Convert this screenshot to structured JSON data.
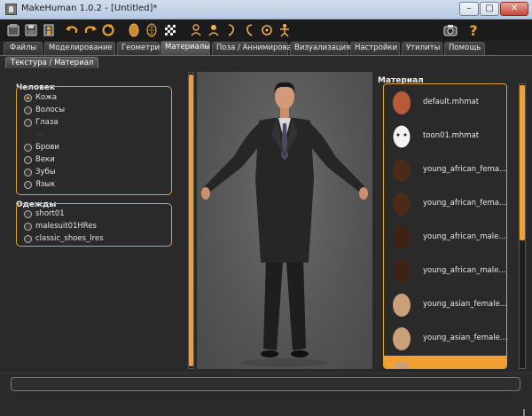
{
  "window": {
    "title": "MakeHuman 1.0.2 - [Untitled]*",
    "minimize": "–",
    "maximize": "□",
    "close": "✕"
  },
  "toolbar": {
    "icons": [
      "new-file-icon",
      "save-icon",
      "export-icon",
      "undo-icon",
      "redo-icon",
      "reset-icon",
      "smooth-icon",
      "wireframe-icon",
      "checkerboard-icon",
      "front-view-icon",
      "back-view-icon",
      "side-view-icon",
      "side-view-right-icon",
      "top-view-icon",
      "skeleton-icon",
      "screenshot-icon",
      "help-icon"
    ],
    "help_label": "?"
  },
  "tabs": [
    {
      "label": "Файлы"
    },
    {
      "label": "Моделирование"
    },
    {
      "label": "Геометрии"
    },
    {
      "label": "Материалы",
      "active": true
    },
    {
      "label": "Поза / Аннимировать"
    },
    {
      "label": "Визуализация"
    },
    {
      "label": "Настройки"
    },
    {
      "label": "Утилиты"
    },
    {
      "label": "Помощь"
    }
  ],
  "subtab": {
    "label": "Текстура / Материал"
  },
  "human_group": {
    "title": "Человек",
    "items": [
      {
        "label": "Кожа",
        "checked": true
      },
      {
        "label": "Волосы"
      },
      {
        "label": "Глаза"
      },
      {
        "label": "—",
        "dim": true
      },
      {
        "label": "Брови"
      },
      {
        "label": "Веки"
      },
      {
        "label": "Зубы"
      },
      {
        "label": "Язык"
      }
    ]
  },
  "clothes_group": {
    "title": "Одежды",
    "items": [
      {
        "label": "short01"
      },
      {
        "label": "malesuit01HRes"
      },
      {
        "label": "classic_shoes_lres"
      }
    ]
  },
  "material": {
    "title": "Материал",
    "items": [
      {
        "label": "default.mhmat",
        "skin": "#b85a3a"
      },
      {
        "label": "toon01.mhmat",
        "skin": "#f2f2f2"
      },
      {
        "label": "young_african_fema...",
        "skin": "#4a2a18"
      },
      {
        "label": "young_african_fema...",
        "skin": "#4a2a18"
      },
      {
        "label": "young_african_male...",
        "skin": "#3e2214"
      },
      {
        "label": "young_african_male...",
        "skin": "#3e2214"
      },
      {
        "label": "young_asian_female...",
        "skin": "#c9a07a"
      },
      {
        "label": "young_asian_female...",
        "skin": "#c9a07a"
      },
      {
        "label": "",
        "skin": "#c9a07a",
        "selected": true
      }
    ]
  },
  "colors": {
    "accent": "#f0a030",
    "background": "#2a2a2a",
    "viewport": "#5a5a5a"
  },
  "log": {
    "text": ""
  }
}
